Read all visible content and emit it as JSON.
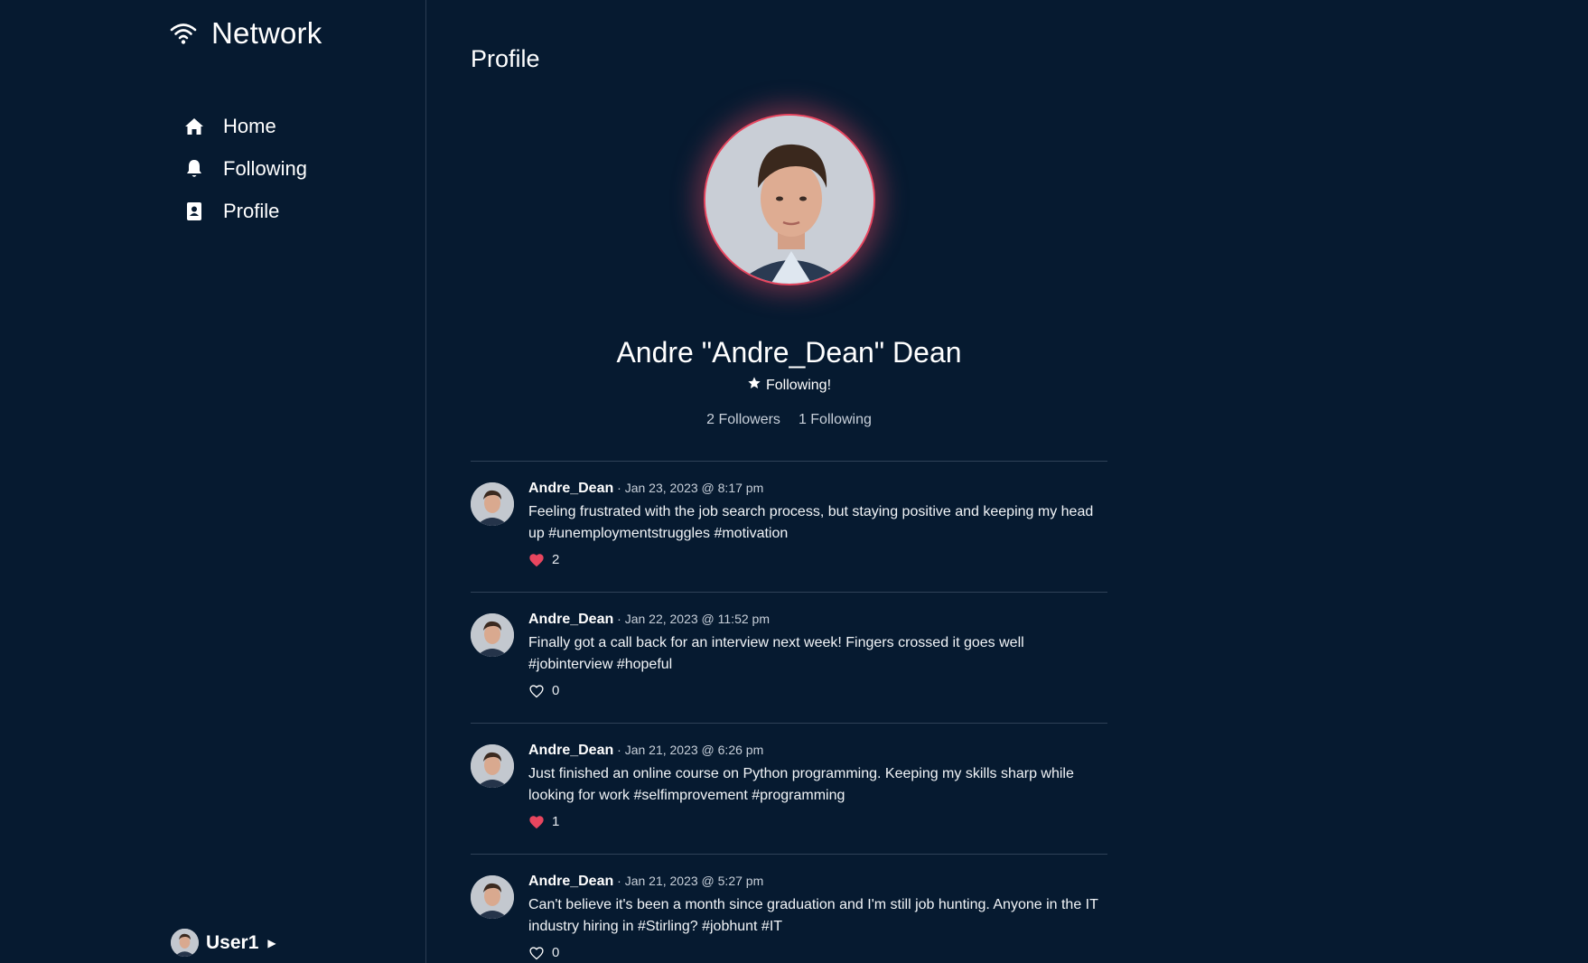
{
  "app": {
    "brand": "Network",
    "nav": [
      {
        "label": "Home",
        "icon": "home-icon"
      },
      {
        "label": "Following",
        "icon": "bell-icon"
      },
      {
        "label": "Profile",
        "icon": "contact-card-icon"
      }
    ],
    "user": {
      "name": "User1"
    }
  },
  "profile": {
    "page_title": "Profile",
    "display_name": "Andre \"Andre_Dean\" Dean",
    "follow_status": "Following!",
    "followers": "2 Followers",
    "following": "1 Following"
  },
  "posts": [
    {
      "username": "Andre_Dean",
      "timestamp": "· Jan 23, 2023 @ 8:17 pm",
      "text": "Feeling frustrated with the job search process, but staying positive and keeping my head up #unemploymentstruggles #motivation",
      "likes": "2",
      "liked": true
    },
    {
      "username": "Andre_Dean",
      "timestamp": "· Jan 22, 2023 @ 11:52 pm",
      "text": "Finally got a call back for an interview next week! Fingers crossed it goes well #jobinterview #hopeful",
      "likes": "0",
      "liked": false
    },
    {
      "username": "Andre_Dean",
      "timestamp": "· Jan 21, 2023 @ 6:26 pm",
      "text": "Just finished an online course on Python programming. Keeping my skills sharp while looking for work #selfimprovement #programming",
      "likes": "1",
      "liked": true
    },
    {
      "username": "Andre_Dean",
      "timestamp": "· Jan 21, 2023 @ 5:27 pm",
      "text": "Can't believe it's been a month since graduation and I'm still job hunting. Anyone in the IT industry hiring in #Stirling? #jobhunt #IT",
      "likes": "0",
      "liked": false
    }
  ],
  "colors": {
    "background": "#061a30",
    "accent": "#e8465f",
    "divider": "#2f4157"
  }
}
